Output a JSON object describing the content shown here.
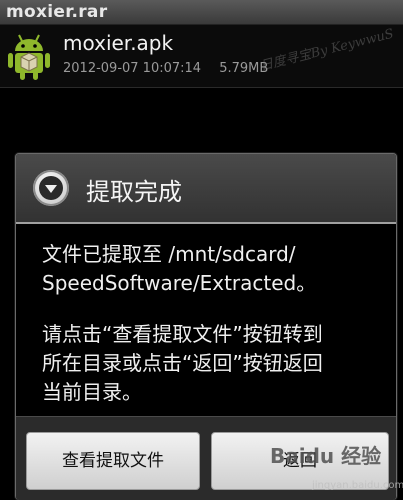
{
  "title_bar": {
    "title": "moxier.rar"
  },
  "file": {
    "name": "moxier.apk",
    "date": "2012-09-07 10:07:14",
    "size": "5.79MB",
    "watermark": "日度寻宝By KeywwuS"
  },
  "dialog": {
    "title": "提取完成",
    "message_1": "文件已提取至 /mnt/sdcard/\nSpeedSoftware/Extracted。",
    "message_2": "请点击“查看提取文件”按钮转到\n所在目录或点击“返回”按钮返回\n当前目录。",
    "view_button": "查看提取文件",
    "back_button": "返回"
  },
  "overlay": {
    "baidu_logo": "Baidu 经验",
    "baidu_url": "jingyan.baidu.com"
  },
  "colors": {
    "android_green": "#8fb82c",
    "dialog_border": "#6a6a6a",
    "button_face": "#e0e0e0"
  }
}
